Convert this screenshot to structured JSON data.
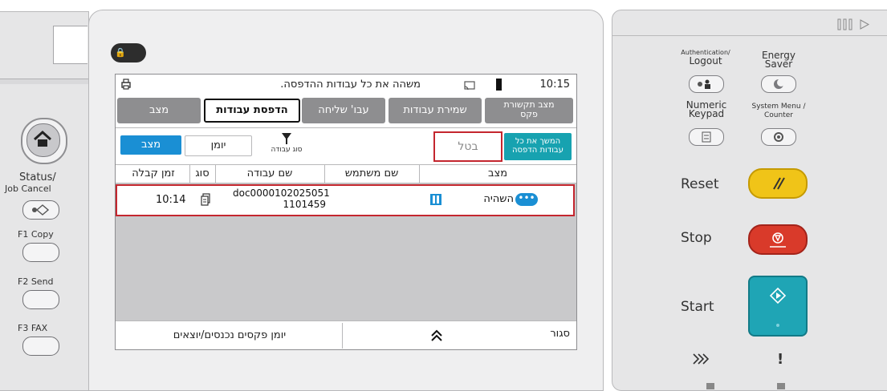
{
  "screen": {
    "status_message": "משהה את כל עבודות ההדפסה.",
    "time": "10:15",
    "tabs": [
      {
        "label": "מצב תקשורת\nפקס"
      },
      {
        "label": "שמירת עבודות"
      },
      {
        "label": "עבו' שליחה"
      },
      {
        "label": "הדפסת עבודות"
      },
      {
        "label": "מצב"
      }
    ],
    "toolbar": {
      "resume_all": "המשך את כל\nעבודות הדפסה",
      "cancel": "בטל",
      "filter_label": "סוג עבודה",
      "log": "יומן",
      "status": "מצב"
    },
    "columns": [
      "מצב",
      "שם משתמש",
      "שם עבודה",
      "סוג",
      "זמן קבלה"
    ],
    "rows": [
      {
        "status": "השהיה",
        "user": "",
        "job_name_line1": "doc0000102025051",
        "job_name_line2": "1101459",
        "received": "10:14"
      }
    ],
    "bottom": {
      "close": "סגור",
      "fax_log": "יומן פקסים נכנסים/יוצאים"
    }
  },
  "left_panel": {
    "status_label_1": "Status/",
    "status_label_2": "Job Cancel",
    "f1": "F1  Copy",
    "f2": "F2  Send",
    "f3": "F3  FAX"
  },
  "right_panel": {
    "auth_label_1": "Authentication/",
    "auth_label_2": "Logout",
    "energy_label_1": "Energy",
    "energy_label_2": "Saver",
    "numeric_label_1": "Numeric",
    "numeric_label_2": "Keypad",
    "sysmenu_label_1": "System Menu /",
    "sysmenu_label_2": "Counter",
    "reset": "Reset",
    "stop": "Stop",
    "start": "Start"
  },
  "colors": {
    "teal": "#17a2b0",
    "reset": "#f0c418",
    "stop": "#d93a2a",
    "start": "#1fa5b5",
    "highlight": "#c4262e"
  }
}
